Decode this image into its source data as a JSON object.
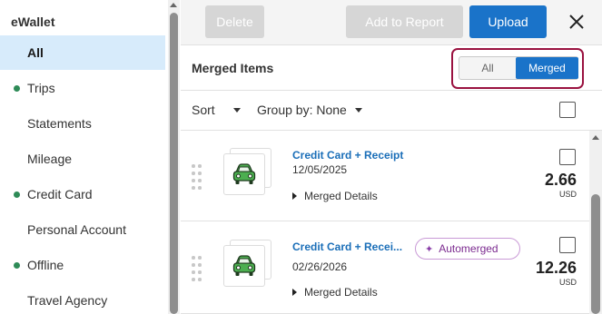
{
  "sidebar": {
    "title": "eWallet",
    "items": [
      {
        "label": "All",
        "active": true,
        "dot": false
      },
      {
        "label": "Trips",
        "active": false,
        "dot": true
      },
      {
        "label": "Statements",
        "active": false,
        "dot": false
      },
      {
        "label": "Mileage",
        "active": false,
        "dot": false
      },
      {
        "label": "Credit Card",
        "active": false,
        "dot": true
      },
      {
        "label": "Personal Account",
        "active": false,
        "dot": false
      },
      {
        "label": "Offline",
        "active": false,
        "dot": true
      },
      {
        "label": "Travel Agency",
        "active": false,
        "dot": false
      }
    ]
  },
  "toolbar": {
    "delete_label": "Delete",
    "add_to_report_label": "Add to Report",
    "upload_label": "Upload",
    "close_icon": "close-icon"
  },
  "merged": {
    "title": "Merged Items",
    "toggle": {
      "all_label": "All",
      "merged_label": "Merged",
      "selected": "Merged"
    }
  },
  "sort_row": {
    "sort_label": "Sort",
    "group_by_label": "Group by: None"
  },
  "items": [
    {
      "title": "Credit Card + Receipt",
      "date": "12/05/2025",
      "details_label": "Merged Details",
      "amount": "2.66",
      "currency": "USD",
      "badge": ""
    },
    {
      "title": "Credit Card + Recei...",
      "date": "02/26/2026",
      "details_label": "Merged Details",
      "amount": "12.26",
      "currency": "USD",
      "badge": "Automerged"
    }
  ],
  "colors": {
    "accent": "#1a73c9",
    "active_nav_bg": "#d7ebfb",
    "status_dot": "#2e8b57",
    "highlight_outline": "#9a1240",
    "badge_text": "#7b2a8f",
    "car_icon": "#4caf50"
  }
}
